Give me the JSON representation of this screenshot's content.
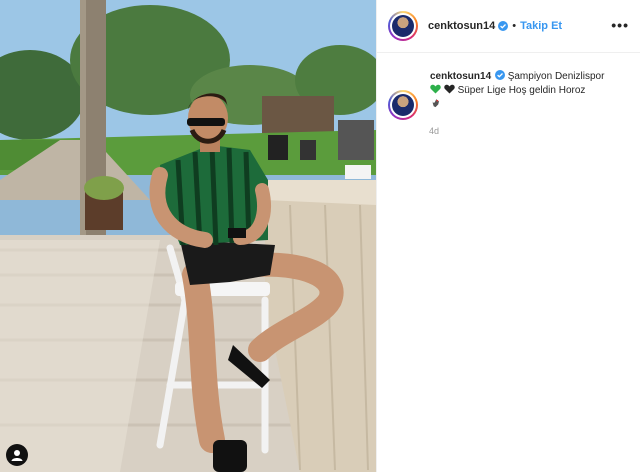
{
  "post": {
    "username": "cenktosun14",
    "follow_label": "Takip Et",
    "separator": "•",
    "more_label": "•••",
    "caption_username": "cenktosun14",
    "caption_line1": "Şampiyon Denizlispor",
    "caption_line2": "Süper Lige Hoş geldin Horoz",
    "time_ago": "4d"
  },
  "colors": {
    "link_blue": "#3897f0",
    "verified_blue": "#3897f0",
    "heart_green": "#2db04b",
    "heart_black": "#262626"
  },
  "icons": {
    "verified": "verified-badge-icon",
    "more": "more-options-icon",
    "green_heart": "green-heart-emoji",
    "black_heart": "black-heart-emoji",
    "rooster": "rooster-emoji",
    "user_tag": "user-tag-icon"
  }
}
